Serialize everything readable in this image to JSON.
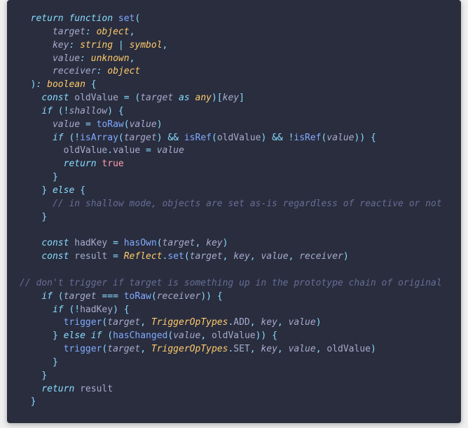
{
  "code": {
    "tokens": [
      {
        "ind": 2,
        "parts": [
          {
            "c": "kw",
            "t": "return"
          },
          {
            "c": "",
            "t": " "
          },
          {
            "c": "kw",
            "t": "function"
          },
          {
            "c": "",
            "t": " "
          },
          {
            "c": "fn",
            "t": "set"
          },
          {
            "c": "punc",
            "t": "("
          }
        ]
      },
      {
        "ind": 6,
        "parts": [
          {
            "c": "arg",
            "t": "target"
          },
          {
            "c": "punci",
            "t": ":"
          },
          {
            "c": "",
            "t": " "
          },
          {
            "c": "type",
            "t": "object"
          },
          {
            "c": "punc",
            "t": ","
          }
        ]
      },
      {
        "ind": 6,
        "parts": [
          {
            "c": "arg",
            "t": "key"
          },
          {
            "c": "punci",
            "t": ":"
          },
          {
            "c": "",
            "t": " "
          },
          {
            "c": "type",
            "t": "string"
          },
          {
            "c": "",
            "t": " "
          },
          {
            "c": "punc",
            "t": "|"
          },
          {
            "c": "",
            "t": " "
          },
          {
            "c": "type",
            "t": "symbol"
          },
          {
            "c": "punc",
            "t": ","
          }
        ]
      },
      {
        "ind": 6,
        "parts": [
          {
            "c": "arg",
            "t": "value"
          },
          {
            "c": "punci",
            "t": ":"
          },
          {
            "c": "",
            "t": " "
          },
          {
            "c": "type",
            "t": "unknown"
          },
          {
            "c": "punc",
            "t": ","
          }
        ]
      },
      {
        "ind": 6,
        "parts": [
          {
            "c": "arg",
            "t": "receiver"
          },
          {
            "c": "punci",
            "t": ":"
          },
          {
            "c": "",
            "t": " "
          },
          {
            "c": "type",
            "t": "object"
          }
        ]
      },
      {
        "ind": 2,
        "parts": [
          {
            "c": "punc",
            "t": ")"
          },
          {
            "c": "punci",
            "t": ":"
          },
          {
            "c": "",
            "t": " "
          },
          {
            "c": "type",
            "t": "boolean"
          },
          {
            "c": "",
            "t": " "
          },
          {
            "c": "punc",
            "t": "{"
          }
        ]
      },
      {
        "ind": 4,
        "parts": [
          {
            "c": "kw",
            "t": "const"
          },
          {
            "c": "",
            "t": " "
          },
          {
            "c": "var",
            "t": "oldValue"
          },
          {
            "c": "",
            "t": " "
          },
          {
            "c": "op",
            "t": "="
          },
          {
            "c": "",
            "t": " "
          },
          {
            "c": "punc",
            "t": "("
          },
          {
            "c": "arg",
            "t": "target"
          },
          {
            "c": "",
            "t": " "
          },
          {
            "c": "kw",
            "t": "as"
          },
          {
            "c": "",
            "t": " "
          },
          {
            "c": "type",
            "t": "any"
          },
          {
            "c": "punc",
            "t": ")["
          },
          {
            "c": "arg",
            "t": "key"
          },
          {
            "c": "punc",
            "t": "]"
          }
        ]
      },
      {
        "ind": 4,
        "parts": [
          {
            "c": "kw",
            "t": "if"
          },
          {
            "c": "",
            "t": " "
          },
          {
            "c": "punc",
            "t": "("
          },
          {
            "c": "op",
            "t": "!"
          },
          {
            "c": "arg",
            "t": "shallow"
          },
          {
            "c": "punc",
            "t": ")"
          },
          {
            "c": "",
            "t": " "
          },
          {
            "c": "punc",
            "t": "{"
          }
        ]
      },
      {
        "ind": 6,
        "parts": [
          {
            "c": "arg",
            "t": "value"
          },
          {
            "c": "",
            "t": " "
          },
          {
            "c": "op",
            "t": "="
          },
          {
            "c": "",
            "t": " "
          },
          {
            "c": "fn",
            "t": "toRaw"
          },
          {
            "c": "punc",
            "t": "("
          },
          {
            "c": "arg",
            "t": "value"
          },
          {
            "c": "punc",
            "t": ")"
          }
        ]
      },
      {
        "ind": 6,
        "parts": [
          {
            "c": "kw",
            "t": "if"
          },
          {
            "c": "",
            "t": " "
          },
          {
            "c": "punc",
            "t": "("
          },
          {
            "c": "op",
            "t": "!"
          },
          {
            "c": "fn",
            "t": "isArray"
          },
          {
            "c": "punc",
            "t": "("
          },
          {
            "c": "arg",
            "t": "target"
          },
          {
            "c": "punc",
            "t": ")"
          },
          {
            "c": "",
            "t": " "
          },
          {
            "c": "op",
            "t": "&&"
          },
          {
            "c": "",
            "t": " "
          },
          {
            "c": "fn",
            "t": "isRef"
          },
          {
            "c": "punc",
            "t": "("
          },
          {
            "c": "var",
            "t": "oldValue"
          },
          {
            "c": "punc",
            "t": ")"
          },
          {
            "c": "",
            "t": " "
          },
          {
            "c": "op",
            "t": "&&"
          },
          {
            "c": "",
            "t": " "
          },
          {
            "c": "op",
            "t": "!"
          },
          {
            "c": "fn",
            "t": "isRef"
          },
          {
            "c": "punc",
            "t": "("
          },
          {
            "c": "arg",
            "t": "value"
          },
          {
            "c": "punc",
            "t": "))"
          },
          {
            "c": "",
            "t": " "
          },
          {
            "c": "punc",
            "t": "{"
          }
        ]
      },
      {
        "ind": 8,
        "parts": [
          {
            "c": "var",
            "t": "oldValue"
          },
          {
            "c": "punc",
            "t": "."
          },
          {
            "c": "prop",
            "t": "value"
          },
          {
            "c": "",
            "t": " "
          },
          {
            "c": "op",
            "t": "="
          },
          {
            "c": "",
            "t": " "
          },
          {
            "c": "arg",
            "t": "value"
          }
        ]
      },
      {
        "ind": 8,
        "parts": [
          {
            "c": "kw",
            "t": "return"
          },
          {
            "c": "",
            "t": " "
          },
          {
            "c": "bool",
            "t": "true"
          }
        ]
      },
      {
        "ind": 6,
        "parts": [
          {
            "c": "punc",
            "t": "}"
          }
        ]
      },
      {
        "ind": 4,
        "parts": [
          {
            "c": "punc",
            "t": "}"
          },
          {
            "c": "",
            "t": " "
          },
          {
            "c": "kw",
            "t": "else"
          },
          {
            "c": "",
            "t": " "
          },
          {
            "c": "punc",
            "t": "{"
          }
        ]
      },
      {
        "ind": 6,
        "parts": [
          {
            "c": "cmt",
            "t": "// in shallow mode, objects are set as-is regardless of reactive or not"
          }
        ]
      },
      {
        "ind": 4,
        "parts": [
          {
            "c": "punc",
            "t": "}"
          }
        ]
      },
      {
        "ind": 0,
        "parts": [
          {
            "c": "",
            "t": " "
          }
        ]
      },
      {
        "ind": 4,
        "parts": [
          {
            "c": "kw",
            "t": "const"
          },
          {
            "c": "",
            "t": " "
          },
          {
            "c": "var",
            "t": "hadKey"
          },
          {
            "c": "",
            "t": " "
          },
          {
            "c": "op",
            "t": "="
          },
          {
            "c": "",
            "t": " "
          },
          {
            "c": "fn",
            "t": "hasOwn"
          },
          {
            "c": "punc",
            "t": "("
          },
          {
            "c": "arg",
            "t": "target"
          },
          {
            "c": "punc",
            "t": ","
          },
          {
            "c": "",
            "t": " "
          },
          {
            "c": "arg",
            "t": "key"
          },
          {
            "c": "punc",
            "t": ")"
          }
        ]
      },
      {
        "ind": 4,
        "parts": [
          {
            "c": "kw",
            "t": "const"
          },
          {
            "c": "",
            "t": " "
          },
          {
            "c": "var",
            "t": "result"
          },
          {
            "c": "",
            "t": " "
          },
          {
            "c": "op",
            "t": "="
          },
          {
            "c": "",
            "t": " "
          },
          {
            "c": "type",
            "t": "Reflect"
          },
          {
            "c": "punc",
            "t": "."
          },
          {
            "c": "fn",
            "t": "set"
          },
          {
            "c": "punc",
            "t": "("
          },
          {
            "c": "arg",
            "t": "target"
          },
          {
            "c": "punc",
            "t": ","
          },
          {
            "c": "",
            "t": " "
          },
          {
            "c": "arg",
            "t": "key"
          },
          {
            "c": "punc",
            "t": ","
          },
          {
            "c": "",
            "t": " "
          },
          {
            "c": "arg",
            "t": "value"
          },
          {
            "c": "punc",
            "t": ","
          },
          {
            "c": "",
            "t": " "
          },
          {
            "c": "arg",
            "t": "receiver"
          },
          {
            "c": "punc",
            "t": ")"
          }
        ]
      },
      {
        "ind": 0,
        "parts": [
          {
            "c": "",
            "t": " "
          }
        ]
      },
      {
        "ind": 0,
        "parts": [
          {
            "c": "cmt",
            "t": "// don't trigger if target is something up in the prototype chain of original"
          }
        ]
      },
      {
        "ind": 4,
        "parts": [
          {
            "c": "kw",
            "t": "if"
          },
          {
            "c": "",
            "t": " "
          },
          {
            "c": "punc",
            "t": "("
          },
          {
            "c": "arg",
            "t": "target"
          },
          {
            "c": "",
            "t": " "
          },
          {
            "c": "op",
            "t": "==="
          },
          {
            "c": "",
            "t": " "
          },
          {
            "c": "fn",
            "t": "toRaw"
          },
          {
            "c": "punc",
            "t": "("
          },
          {
            "c": "arg",
            "t": "receiver"
          },
          {
            "c": "punc",
            "t": "))"
          },
          {
            "c": "",
            "t": " "
          },
          {
            "c": "punc",
            "t": "{"
          }
        ]
      },
      {
        "ind": 6,
        "parts": [
          {
            "c": "kw",
            "t": "if"
          },
          {
            "c": "",
            "t": " "
          },
          {
            "c": "punc",
            "t": "("
          },
          {
            "c": "op",
            "t": "!"
          },
          {
            "c": "var",
            "t": "hadKey"
          },
          {
            "c": "punc",
            "t": ")"
          },
          {
            "c": "",
            "t": " "
          },
          {
            "c": "punc",
            "t": "{"
          }
        ]
      },
      {
        "ind": 8,
        "parts": [
          {
            "c": "fn",
            "t": "trigger"
          },
          {
            "c": "punc",
            "t": "("
          },
          {
            "c": "arg",
            "t": "target"
          },
          {
            "c": "punc",
            "t": ","
          },
          {
            "c": "",
            "t": " "
          },
          {
            "c": "type",
            "t": "TriggerOpTypes"
          },
          {
            "c": "punc",
            "t": "."
          },
          {
            "c": "var",
            "t": "ADD"
          },
          {
            "c": "punc",
            "t": ","
          },
          {
            "c": "",
            "t": " "
          },
          {
            "c": "arg",
            "t": "key"
          },
          {
            "c": "punc",
            "t": ","
          },
          {
            "c": "",
            "t": " "
          },
          {
            "c": "arg",
            "t": "value"
          },
          {
            "c": "punc",
            "t": ")"
          }
        ]
      },
      {
        "ind": 6,
        "parts": [
          {
            "c": "punc",
            "t": "}"
          },
          {
            "c": "",
            "t": " "
          },
          {
            "c": "kw",
            "t": "else"
          },
          {
            "c": "",
            "t": " "
          },
          {
            "c": "kw",
            "t": "if"
          },
          {
            "c": "",
            "t": " "
          },
          {
            "c": "punc",
            "t": "("
          },
          {
            "c": "fn",
            "t": "hasChanged"
          },
          {
            "c": "punc",
            "t": "("
          },
          {
            "c": "arg",
            "t": "value"
          },
          {
            "c": "punc",
            "t": ","
          },
          {
            "c": "",
            "t": " "
          },
          {
            "c": "var",
            "t": "oldValue"
          },
          {
            "c": "punc",
            "t": "))"
          },
          {
            "c": "",
            "t": " "
          },
          {
            "c": "punc",
            "t": "{"
          }
        ]
      },
      {
        "ind": 8,
        "parts": [
          {
            "c": "fn",
            "t": "trigger"
          },
          {
            "c": "punc",
            "t": "("
          },
          {
            "c": "arg",
            "t": "target"
          },
          {
            "c": "punc",
            "t": ","
          },
          {
            "c": "",
            "t": " "
          },
          {
            "c": "type",
            "t": "TriggerOpTypes"
          },
          {
            "c": "punc",
            "t": "."
          },
          {
            "c": "var",
            "t": "SET"
          },
          {
            "c": "punc",
            "t": ","
          },
          {
            "c": "",
            "t": " "
          },
          {
            "c": "arg",
            "t": "key"
          },
          {
            "c": "punc",
            "t": ","
          },
          {
            "c": "",
            "t": " "
          },
          {
            "c": "arg",
            "t": "value"
          },
          {
            "c": "punc",
            "t": ","
          },
          {
            "c": "",
            "t": " "
          },
          {
            "c": "var",
            "t": "oldValue"
          },
          {
            "c": "punc",
            "t": ")"
          }
        ]
      },
      {
        "ind": 6,
        "parts": [
          {
            "c": "punc",
            "t": "}"
          }
        ]
      },
      {
        "ind": 4,
        "parts": [
          {
            "c": "punc",
            "t": "}"
          }
        ]
      },
      {
        "ind": 4,
        "parts": [
          {
            "c": "kw",
            "t": "return"
          },
          {
            "c": "",
            "t": " "
          },
          {
            "c": "var",
            "t": "result"
          }
        ]
      },
      {
        "ind": 2,
        "parts": [
          {
            "c": "punc",
            "t": "}"
          }
        ]
      }
    ]
  }
}
